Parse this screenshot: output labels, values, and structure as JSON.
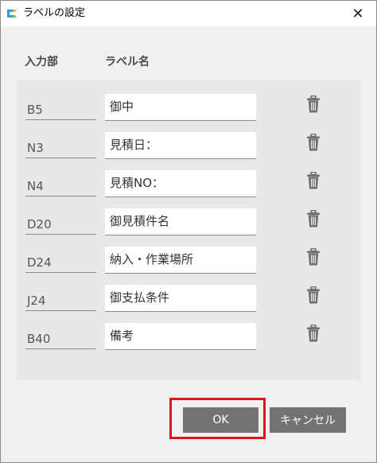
{
  "window": {
    "title": "ラベルの設定",
    "close_symbol": "✕"
  },
  "headers": {
    "input_part": "入力部",
    "label_name": "ラベル名"
  },
  "rows": [
    {
      "part": "B5",
      "label": "御中"
    },
    {
      "part": "N3",
      "label": "見積日："
    },
    {
      "part": "N4",
      "label": "見積NO："
    },
    {
      "part": "D20",
      "label": "御見積件名"
    },
    {
      "part": "D24",
      "label": "納入・作業場所"
    },
    {
      "part": "J24",
      "label": "御支払条件"
    },
    {
      "part": "B40",
      "label": "備考"
    }
  ],
  "buttons": {
    "ok": "OK",
    "cancel": "キャンセル"
  },
  "colors": {
    "highlight": "#e0141e",
    "button_bg": "#737373"
  },
  "icons": {
    "app": "app-logo-icon",
    "close": "close-icon",
    "delete": "trash-icon"
  }
}
